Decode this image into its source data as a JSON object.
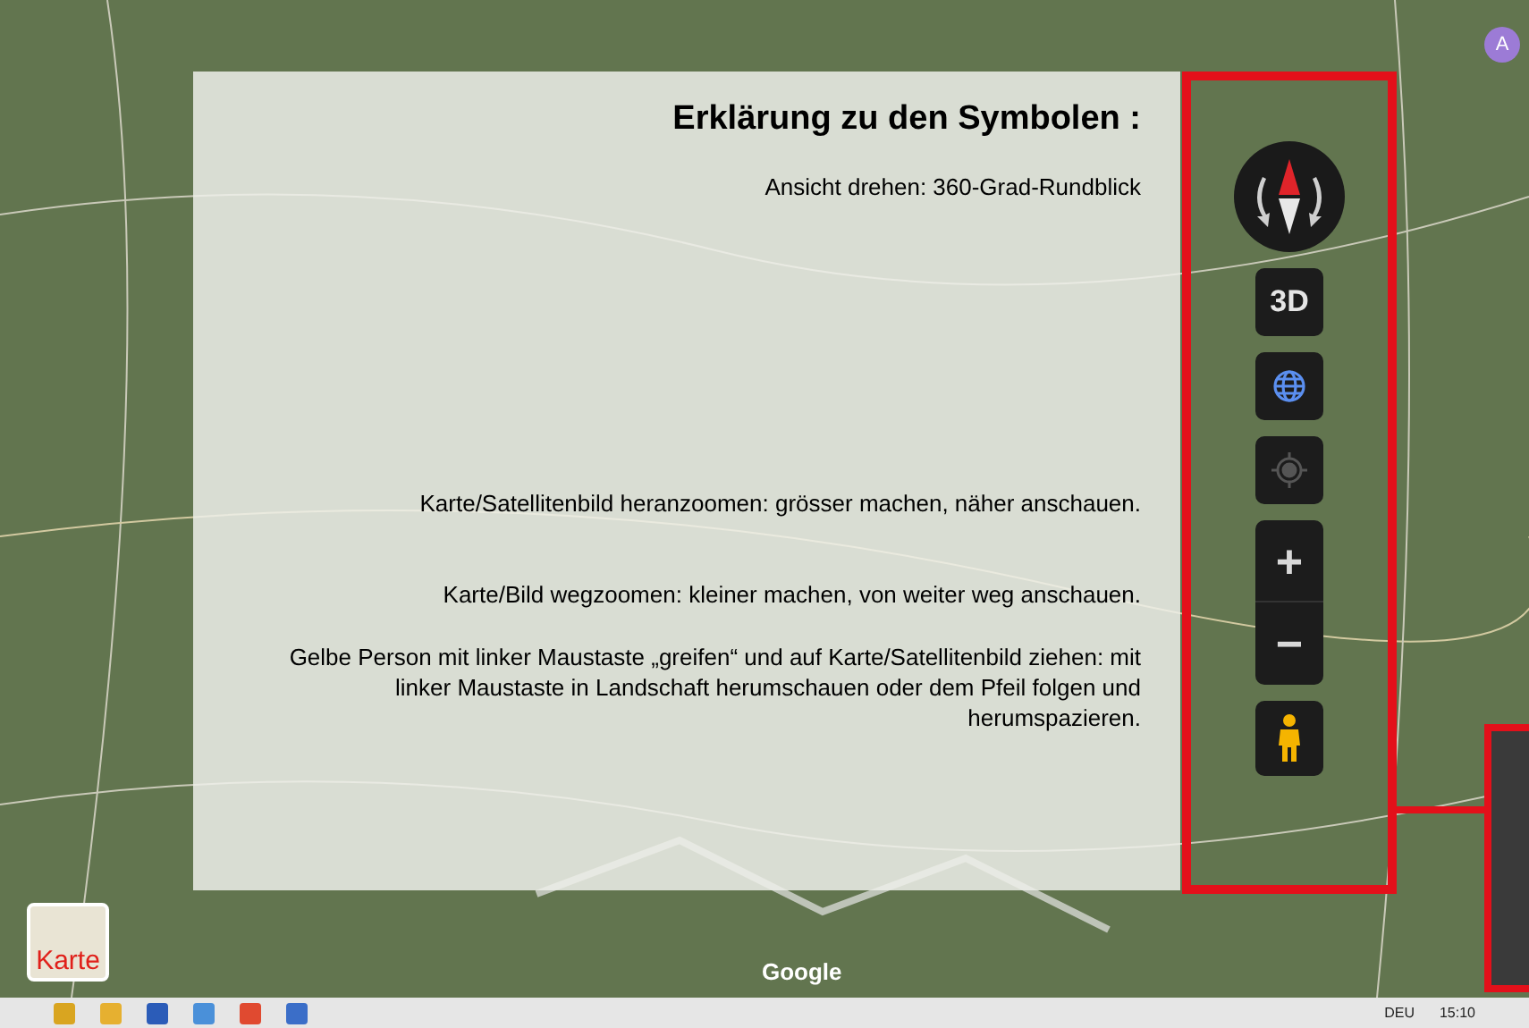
{
  "panel": {
    "title": "Erklärung zu den Symbolen :",
    "explanations": [
      {
        "kind": "rotate",
        "text": "Ansicht drehen: 360-Grad-Rundblick"
      },
      {
        "kind": "zoom_in",
        "text": "Karte/Satellitenbild heranzoomen: grösser machen, näher anschauen."
      },
      {
        "kind": "zoom_out",
        "text": "Karte/Bild wegzoomen: kleiner machen, von weiter weg anschauen."
      },
      {
        "kind": "pegman",
        "text": "Gelbe Person mit linker Maustaste „greifen“ und auf Karte/Satellitenbild ziehen: mit linker Maustaste in Landschaft herumschauen oder dem Pfeil folgen und herumspazieren."
      }
    ]
  },
  "controls": [
    {
      "kind": "compass"
    },
    {
      "kind": "tilt",
      "label": "3D"
    },
    {
      "kind": "globe"
    },
    {
      "kind": "locate"
    },
    {
      "kind": "zoom",
      "plus": "+",
      "minus": "−"
    },
    {
      "kind": "pegman"
    }
  ],
  "map_type_button": {
    "label": "Karte"
  },
  "map_logo": "Google",
  "account": {
    "initial": "A"
  },
  "taskbar": {
    "language": "DEU",
    "time": "15:10"
  }
}
